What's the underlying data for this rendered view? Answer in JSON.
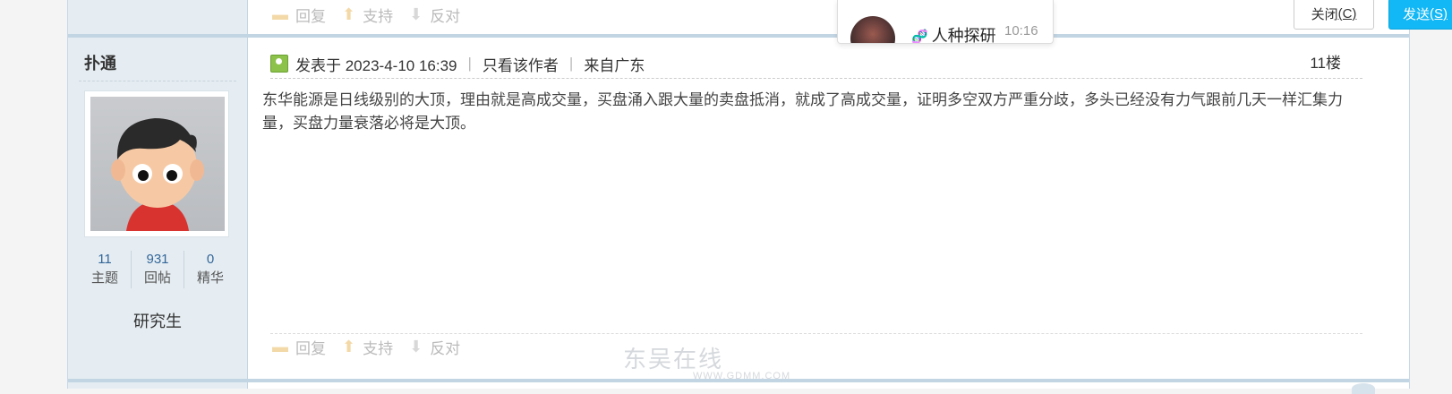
{
  "actions_top": {
    "reply": "回复",
    "support": "支持",
    "oppose": "反对"
  },
  "actions_bottom": {
    "reply": "回复",
    "support": "支持",
    "oppose": "反对"
  },
  "author": {
    "name": "扑通",
    "stats": [
      {
        "num": "11",
        "label": "主题"
      },
      {
        "num": "931",
        "label": "回帖"
      },
      {
        "num": "0",
        "label": "精华"
      }
    ],
    "rank": "研究生"
  },
  "post": {
    "posted_at": "发表于 2023-4-10 16:39",
    "author_only": "只看该作者",
    "from": "来自广东",
    "floor": "11楼",
    "body": "东华能源是日线级别的大顶，理由就是高成交量，买盘涌入跟大量的卖盘抵消，就成了高成交量，证明多空双方严重分歧，多头已经没有力气跟前几天一样汇集力量，买盘力量衰落必将是大顶。"
  },
  "chat": {
    "name": "人种探研",
    "time": "10:16",
    "close_label": "关闭",
    "close_key": "(C)",
    "send_label": "发送",
    "send_key": "(S)"
  },
  "watermark": {
    "main": "东吴在线",
    "sub": "WWW.GDMM.COM"
  }
}
